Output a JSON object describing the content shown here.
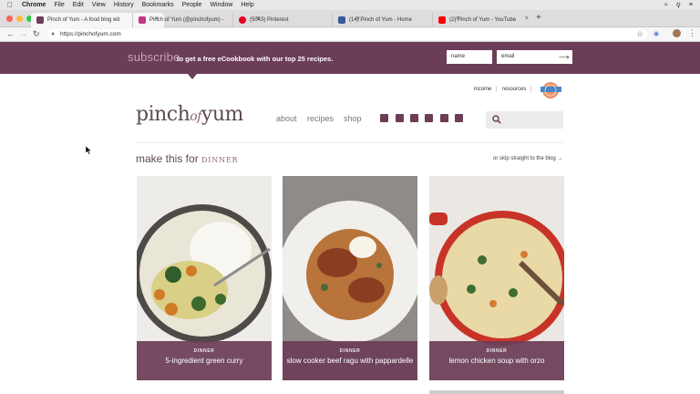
{
  "mac_menu": {
    "app": "Chrome",
    "items": [
      "File",
      "Edit",
      "View",
      "History",
      "Bookmarks",
      "People",
      "Window",
      "Help"
    ]
  },
  "tabs": [
    {
      "label": "Pinch of Yum - A food blog wit",
      "favicon_color": "#6c3d57",
      "active": true
    },
    {
      "label": "Pinch of Yum (@pinchofyum) -",
      "favicon_color": "#c13584",
      "active": false
    },
    {
      "label": "(5043) Pinterest",
      "favicon_color": "#e60023",
      "active": false
    },
    {
      "label": "(14) Pinch of Yum - Home",
      "favicon_color": "#3b5998",
      "active": false
    },
    {
      "label": "(2) Pinch of Yum - YouTube",
      "favicon_color": "#ff0000",
      "active": false
    }
  ],
  "address": {
    "url": "https://pinchofyum.com"
  },
  "banner": {
    "subscribe_word": "subscribe",
    "text": "to get a free eCookbook with our top 25 recipes.",
    "name_placeholder": "name",
    "email_placeholder": "email",
    "submit_icon": "arrow-right-icon",
    "color": "#6c3d57"
  },
  "top_links": {
    "income": "income",
    "resources": "resources",
    "sep": "|"
  },
  "logo": {
    "a": "pinch",
    "b": "of",
    "c": "yum"
  },
  "nav": {
    "about": "about",
    "recipes": "recipes",
    "shop": "shop"
  },
  "social_icons": [
    "facebook-icon",
    "instagram-icon",
    "twitter-icon",
    "pinterest-icon",
    "heart-icon",
    "other-icon"
  ],
  "section": {
    "title": "make this for",
    "meal": "DINNER",
    "skip": "or skip straight to the blog →"
  },
  "cards": [
    {
      "category": "DINNER",
      "title": "5-ingredient green curry"
    },
    {
      "category": "DINNER",
      "title": "slow cooker beef ragu with pappardelle"
    },
    {
      "category": "DINNER",
      "title": "lemon chicken soup with orzo"
    }
  ]
}
